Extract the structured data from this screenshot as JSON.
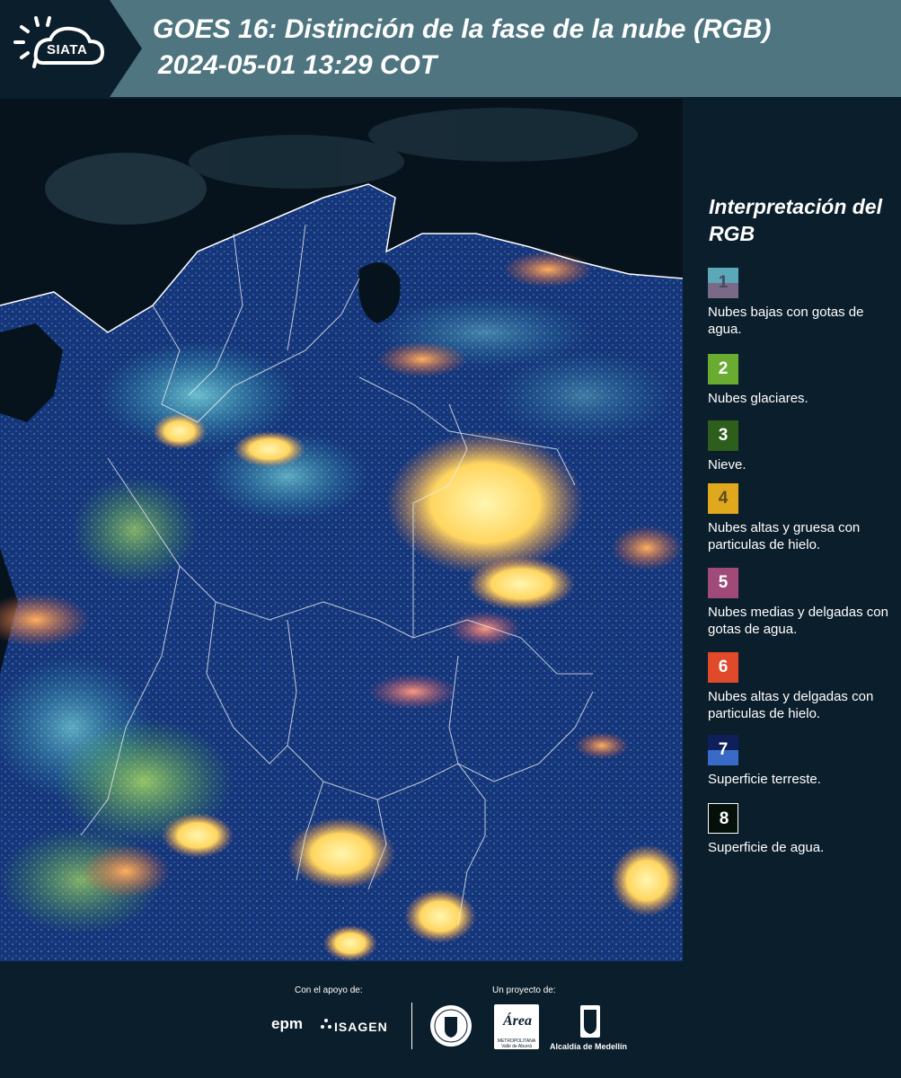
{
  "header": {
    "logo_text": "SIATA",
    "title": "GOES 16: Distinción de la fase de la nube (RGB)",
    "subtitle": "2024-05-01 13:29 COT"
  },
  "legend": {
    "title": "Interpretación del RGB",
    "items": [
      {
        "number": "1",
        "label": "Nubes bajas con gotas de agua.",
        "color_top": "#5aa8b8",
        "color_bottom": "#7a6a88",
        "text_color": "#4a4560"
      },
      {
        "number": "2",
        "label": "Nubes glaciares.",
        "color_top": "#6aab32",
        "color_bottom": "#6aab32",
        "text_color": "#ffffff"
      },
      {
        "number": "3",
        "label": "Nieve.",
        "color_top": "#2e5e1c",
        "color_bottom": "#2e5e1c",
        "text_color": "#ffffff"
      },
      {
        "number": "4",
        "label": "Nubes altas y gruesa con particulas de hielo.",
        "color_top": "#e0a81c",
        "color_bottom": "#e0a81c",
        "text_color": "#5a4a20"
      },
      {
        "number": "5",
        "label": "Nubes medias y delgadas con gotas de agua.",
        "color_top": "#a04a7a",
        "color_bottom": "#a04a7a",
        "text_color": "#ffffff"
      },
      {
        "number": "6",
        "label": "Nubes altas y delgadas con particulas de hielo.",
        "color_top": "#e04a2a",
        "color_bottom": "#e04a2a",
        "text_color": "#ffffff"
      },
      {
        "number": "7",
        "label": "Superficie terreste.",
        "color_top": "#0e1f5a",
        "color_bottom": "#3a6ac8",
        "text_color": "#ffffff"
      },
      {
        "number": "8",
        "label": "Superficie de agua.",
        "color_top": "#05100a",
        "color_bottom": "#05100a",
        "text_color": "#ffffff"
      }
    ]
  },
  "footer": {
    "support_label": "Con el apoyo de:",
    "project_label": "Un proyecto de:",
    "sponsor_1": "epm",
    "sponsor_2": "ISAGEN",
    "partner_1": "Área",
    "partner_1_sub": "METROPOLITANA Valle de Aburrá",
    "partner_2": "Alcaldía de Medellín"
  },
  "colors": {
    "header_bg": "#4e7580",
    "page_bg": "#0b1e2b",
    "land": "#1a3a8a",
    "ocean": "#06131c",
    "cloud_warm": "#ffe27a",
    "cloud_orange": "#f08a4a",
    "cloud_cyan": "#5fe3e0",
    "cloud_green": "#9aef4a"
  }
}
